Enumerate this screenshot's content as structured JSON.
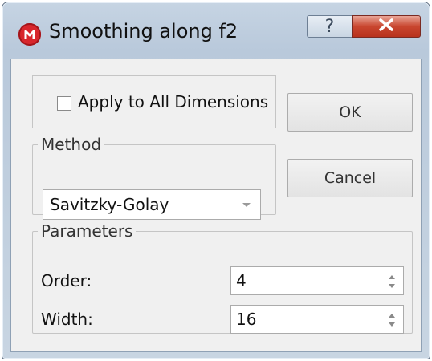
{
  "window": {
    "title": "Smoothing along f2",
    "help_label": "?",
    "close_label": "X"
  },
  "apply_all": {
    "label": "Apply to All Dimensions",
    "checked": false
  },
  "buttons": {
    "ok": "OK",
    "cancel": "Cancel"
  },
  "method": {
    "legend": "Method",
    "selected": "Savitzky-Golay"
  },
  "parameters": {
    "legend": "Parameters",
    "order_label": "Order:",
    "order_value": "4",
    "width_label": "Width:",
    "width_value": "16"
  },
  "icons": {
    "app": "app-logo-icon",
    "help": "help-icon",
    "close": "close-icon",
    "dropdown": "chevron-down-icon"
  },
  "colors": {
    "close_button": "#c9462f",
    "app_icon": "#d8262c",
    "dialog_background": "#f0f0f0"
  }
}
